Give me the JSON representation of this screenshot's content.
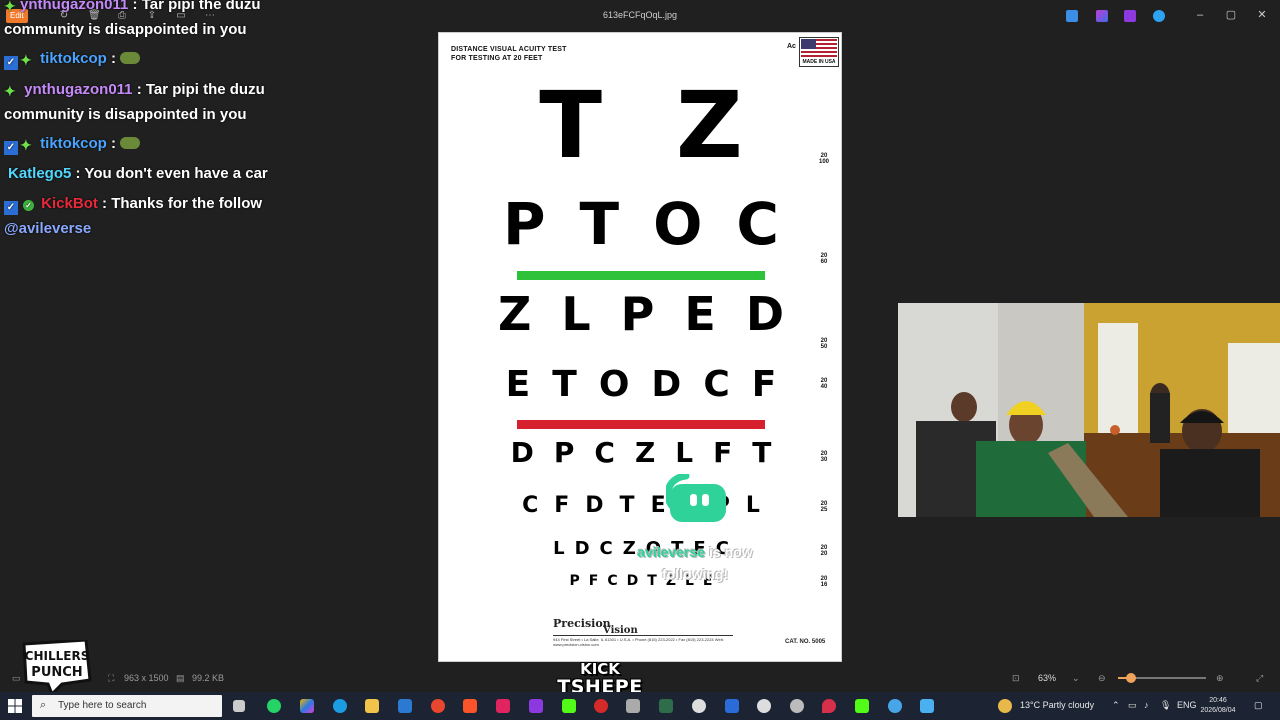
{
  "window": {
    "title": "613eFCFqOqL.jpg",
    "edit_label": "Edit"
  },
  "chat": [
    {
      "user": "ynthugazon011",
      "text": ": Tar pipi the duzu",
      "cont": "community is disappointed in you"
    },
    {
      "user": "tiktokcop",
      "text": ":"
    },
    {
      "user": "ynthugazon011",
      "text": ": Tar pipi the duzu",
      "cont": "community is disappointed in you"
    },
    {
      "user": "tiktokcop",
      "text": ":"
    },
    {
      "user": "Katlego5",
      "text": ": You don't even have a car"
    },
    {
      "user": "KickBot",
      "text": ": Thanks for the follow",
      "cont": "@avileverse"
    }
  ],
  "eye_chart": {
    "header_line1": "DISTANCE VISUAL ACUITY TEST",
    "header_line2": "FOR TESTING AT 20 FEET",
    "acc": "Ac",
    "flag_text": "MADE IN USA",
    "rows": [
      {
        "letters": [
          "T",
          "Z"
        ],
        "ratio_top": "20",
        "ratio_bottom": "100"
      },
      {
        "letters": [
          "P",
          "T",
          "O",
          "C"
        ],
        "ratio_top": "20",
        "ratio_bottom": "60"
      },
      {
        "letters": [
          "Z",
          "L",
          "P",
          "E",
          "D"
        ],
        "ratio_top": "20",
        "ratio_bottom": "50"
      },
      {
        "letters": [
          "E",
          "T",
          "O",
          "D",
          "C",
          "F"
        ],
        "ratio_top": "20",
        "ratio_bottom": "40"
      },
      {
        "letters": [
          "D",
          "P",
          "C",
          "Z",
          "L",
          "F",
          "T"
        ],
        "ratio_top": "20",
        "ratio_bottom": "30"
      },
      {
        "letters": [
          "C",
          "F",
          "D",
          "T",
          "E",
          "C",
          "P",
          "L"
        ],
        "ratio_top": "20",
        "ratio_bottom": "25"
      },
      {
        "letters": [
          "L",
          "D",
          "C",
          "Z",
          "O",
          "T",
          "E",
          "C"
        ],
        "ratio_top": "20",
        "ratio_bottom": "20"
      },
      {
        "letters": [
          "P",
          "F",
          "C",
          "D",
          "T",
          "Z",
          "L",
          "E"
        ],
        "ratio_top": "20",
        "ratio_bottom": "16"
      }
    ],
    "brand_line1": "Precision",
    "brand_line2": "Vision",
    "address": "944 First Street • La Salle, IL 61301 • U.S.A. • Phone (815) 223-2022 • Fax (815) 223-2224  Web: www.precision-vision.com",
    "cat_no": "CAT. NO. 5005",
    "green_bar_color": "#2ec23a",
    "red_bar_color": "#d6202e"
  },
  "alert": {
    "name": "avileverse",
    "line1_rest": " is now",
    "line2": "following!"
  },
  "statusbar": {
    "dimensions": "963 x 1500",
    "filesize": "99.2 KB",
    "zoom": "63%",
    "zoom_level": 0.15
  },
  "overlay": {
    "logo_line1": "CHILLERS",
    "logo_line2": "PUNCH",
    "kick": "KICK",
    "streamer": "TSHEPE"
  },
  "taskbar": {
    "search_placeholder": "Type here to search",
    "weather": "13°C  Partly cloudy",
    "language": "ENG",
    "time": "20:46",
    "date": "2026/08/04"
  }
}
